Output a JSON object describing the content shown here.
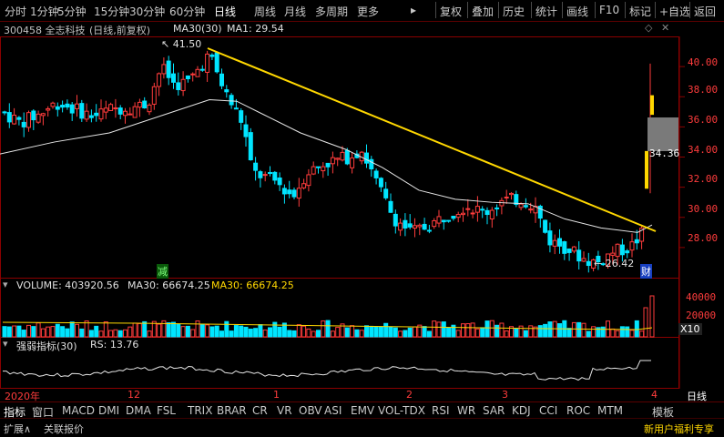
{
  "toolbar": {
    "left_items": [
      "分时",
      "1分钟",
      "5分钟",
      "15分钟",
      "30分钟",
      "60分钟",
      "日线",
      "周线",
      "月线",
      "多周期",
      "更多"
    ],
    "active": "日线",
    "right_items": [
      "复权",
      "叠加",
      "历史",
      "统计",
      "画线",
      "F10",
      "标记",
      "+自选",
      "返回"
    ]
  },
  "info": {
    "code_name": "300458 全志科技",
    "mode": "(日线,前复权)",
    "ma_label": "MA30(30)",
    "ma1": "MA1: 29.54"
  },
  "price_axis": [
    "40.00",
    "38.00",
    "36.00",
    "34.00",
    "32.00",
    "30.00",
    "28.00"
  ],
  "current_price_tag": "34.36",
  "annotations": {
    "high": "41.50",
    "low": "26.42",
    "badge_jian": "减",
    "badge_cai": "财"
  },
  "volume": {
    "label": "VOLUME: 403920.56",
    "ma30_a": "MA30: 66674.25",
    "ma30_b": "MA30: 66674.25",
    "axis": [
      "40000",
      "20000"
    ],
    "unit": "X10"
  },
  "rs": {
    "name": "强弱指标(30)",
    "value": "RS: 13.76"
  },
  "dates": {
    "year": "2020年",
    "months": [
      "12",
      "1",
      "2",
      "3",
      "4"
    ],
    "right": "日线"
  },
  "indicator_tabs": [
    "指标",
    "窗口",
    "MACD",
    "DMI",
    "DMA",
    "FSL",
    "TRIX",
    "BRAR",
    "CR",
    "VR",
    "OBV",
    "ASI",
    "EMV",
    "VOL-TDX",
    "RSI",
    "WR",
    "SAR",
    "KDJ",
    "CCI",
    "ROC",
    "MTM"
  ],
  "indicator_right": "模板",
  "bottom": {
    "left": [
      "扩展∧",
      "关联报价"
    ],
    "right": "新用户福利专享"
  },
  "colors": {
    "up": "#ff3c3c",
    "down": "#00e5ff",
    "ma_white": "#e6e6e6",
    "trend": "#ffd700"
  },
  "chart_data": {
    "type": "candlestick",
    "price_ylim": [
      26,
      42
    ],
    "high": 41.5,
    "low": 26.42,
    "ma30_end": 29.54,
    "volume_ylim": [
      0,
      45000
    ]
  }
}
